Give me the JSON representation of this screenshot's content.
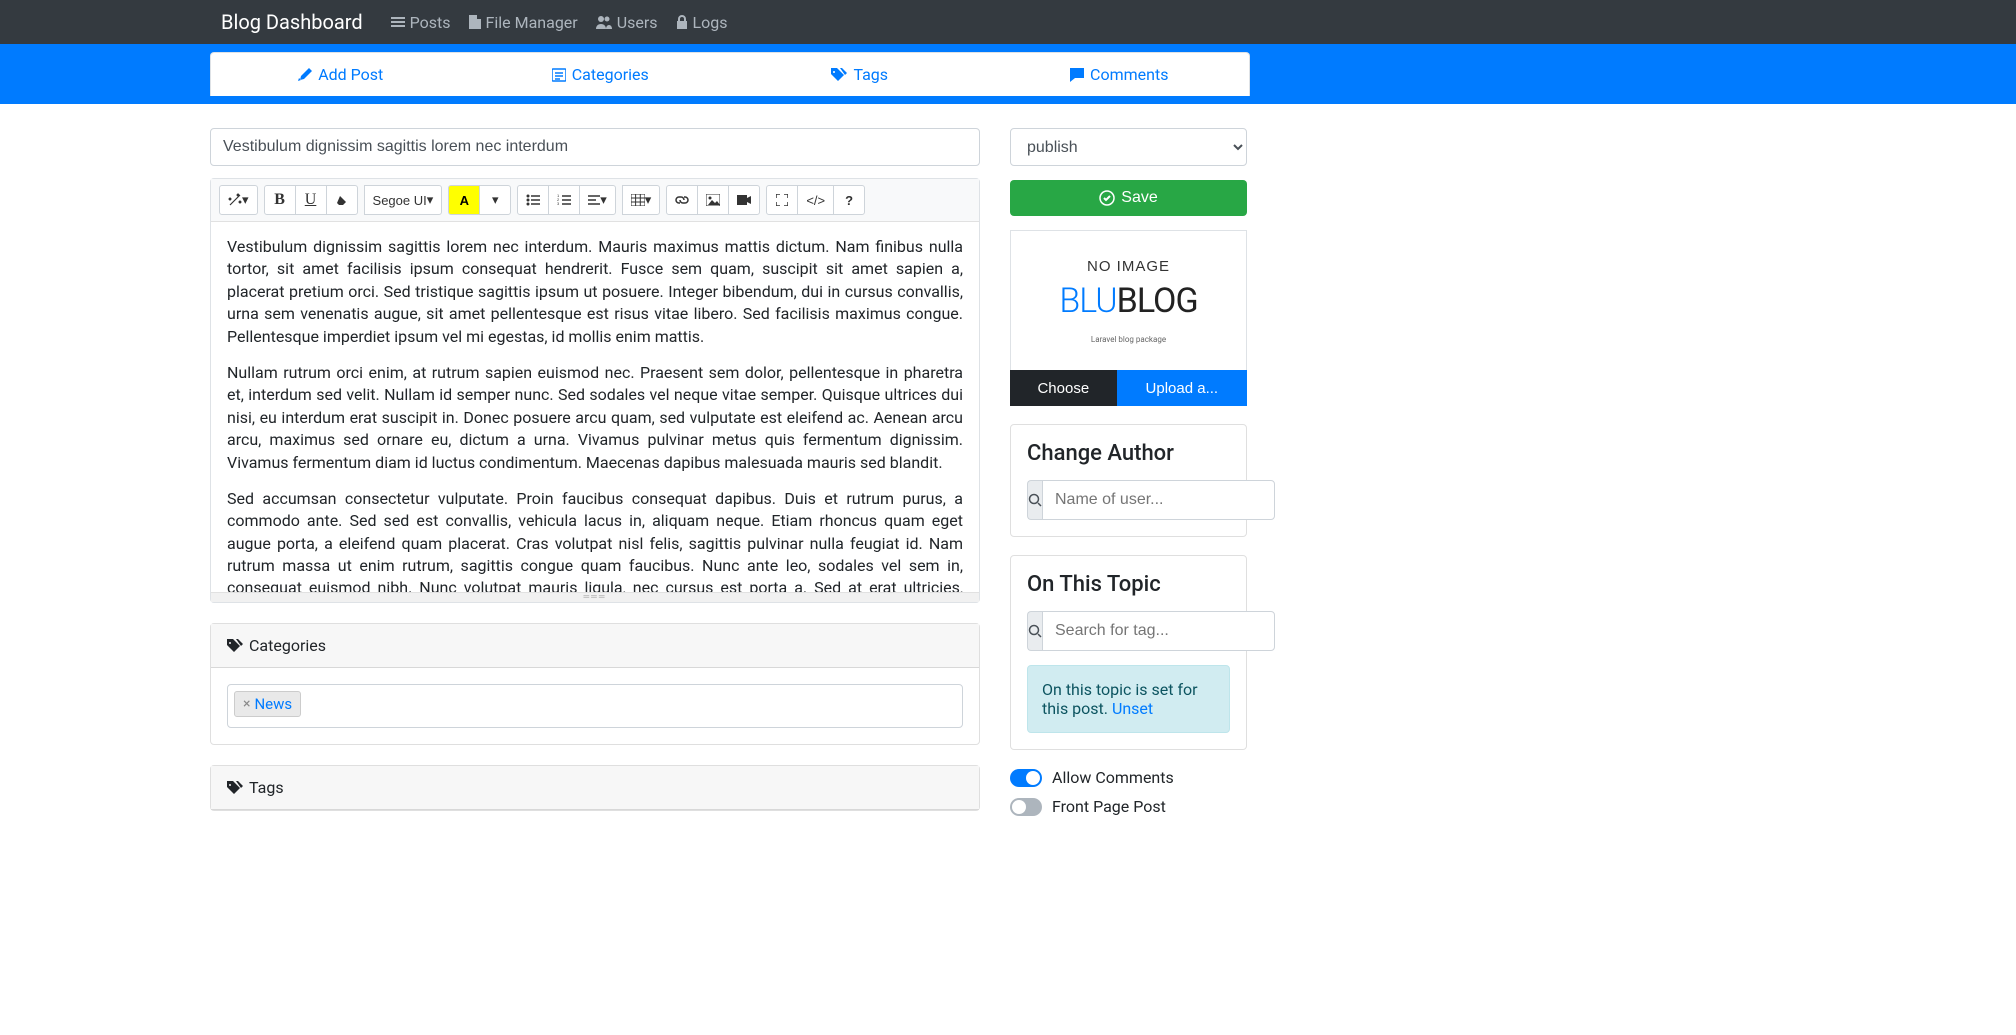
{
  "navbar": {
    "brand": "Blog Dashboard",
    "links": {
      "posts": "Posts",
      "file_manager": "File Manager",
      "users": "Users",
      "logs": "Logs"
    }
  },
  "tabs": {
    "add_post": "Add Post",
    "categories": "Categories",
    "tags": "Tags",
    "comments": "Comments"
  },
  "post": {
    "title": "Vestibulum dignissim sagittis lorem nec interdum",
    "paragraphs": [
      "Vestibulum dignissim sagittis lorem nec interdum. Mauris maximus mattis dictum. Nam finibus nulla tortor, sit amet facilisis ipsum consequat hendrerit. Fusce sem quam, suscipit sit amet sapien a, placerat pretium orci. Sed tristique sagittis ipsum ut posuere. Integer bibendum, dui in cursus convallis, urna sem venenatis augue, sit amet pellentesque est risus vitae libero. Sed facilisis maximus congue. Pellentesque imperdiet ipsum vel mi egestas, id mollis enim mattis.",
      "Nullam rutrum orci enim, at rutrum sapien euismod nec. Praesent sem dolor, pellentesque in pharetra et, interdum sed velit. Nullam id semper nunc. Sed sodales vel neque vitae semper. Quisque ultrices dui nisi, eu interdum erat suscipit in. Donec posuere arcu quam, sed vulputate est eleifend ac. Aenean arcu arcu, maximus sed ornare eu, dictum a urna. Vivamus pulvinar metus quis fermentum dignissim. Vivamus fermentum diam id luctus condimentum. Maecenas dapibus malesuada mauris sed blandit.",
      "Sed accumsan consectetur vulputate. Proin faucibus consequat dapibus. Duis et rutrum purus, a commodo ante. Sed sed est convallis, vehicula lacus in, aliquam neque. Etiam rhoncus quam eget augue porta, a eleifend quam placerat. Cras volutpat nisl felis, sagittis pulvinar nulla feugiat id. Nam rutrum massa ut enim rutrum, sagittis congue quam faucibus. Nunc ante leo, sodales vel sem in, consequat euismod nibh. Nunc volutpat mauris ligula, nec cursus est porta a. Sed at erat ultricies, rutrum est eu, imperdiet orci. Duis aliquam"
    ]
  },
  "toolbar": {
    "font_family": "Segoe UI",
    "bold": "B",
    "underline": "U",
    "highlight": "A",
    "codeview": "</>",
    "help": "?"
  },
  "sections": {
    "categories": "Categories",
    "tags": "Tags"
  },
  "category_tags": {
    "news": "News"
  },
  "sidebar": {
    "status_selected": "publish",
    "save": "Save",
    "no_image": "NO IMAGE",
    "logo_blu": "BLU",
    "logo_blog": "BLOG",
    "logo_sub": "Laravel blog package",
    "choose": "Choose",
    "upload": "Upload a...",
    "change_author": "Change Author",
    "author_placeholder": "Name of user...",
    "on_topic": "On This Topic",
    "tag_placeholder": "Search for tag...",
    "topic_notice": "On this topic is set for this post. ",
    "unset": "Unset",
    "allow_comments": "Allow Comments",
    "front_page": "Front Page Post"
  }
}
